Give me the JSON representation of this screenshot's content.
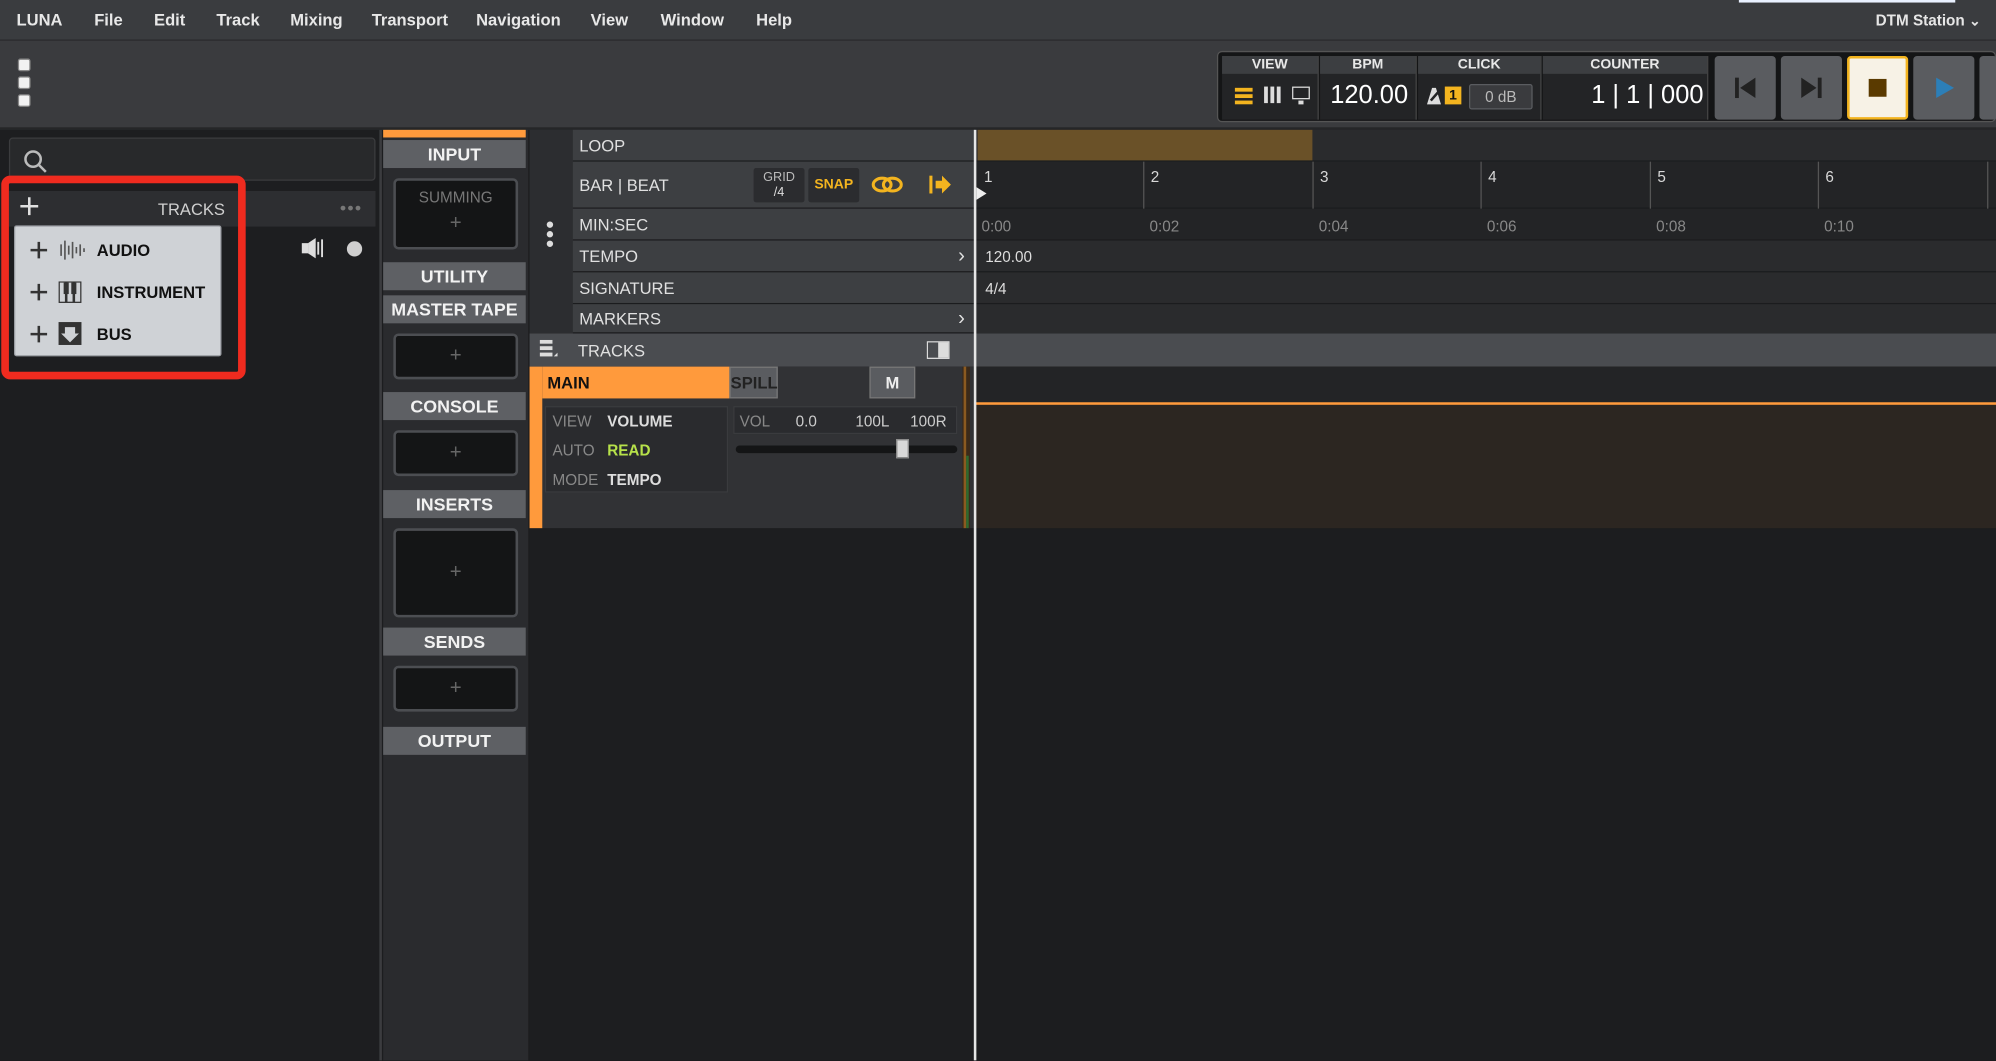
{
  "menu": {
    "items": [
      "LUNA",
      "File",
      "Edit",
      "Track",
      "Mixing",
      "Transport",
      "Navigation",
      "View",
      "Window",
      "Help"
    ],
    "station": "DTM Station"
  },
  "transport": {
    "view_label": "VIEW",
    "bpm_label": "BPM",
    "bpm_value": "120.00",
    "click_label": "CLICK",
    "click_badge": "1",
    "click_db": "0 dB",
    "counter_label": "COUNTER",
    "counter_value": "1 | 1 | 000"
  },
  "tracks_panel": {
    "header": "TRACKS",
    "dropdown": [
      "AUDIO",
      "INSTRUMENT",
      "BUS"
    ]
  },
  "channel_strip": {
    "sections": [
      "INPUT",
      "UTILITY",
      "MASTER TAPE",
      "CONSOLE",
      "INSERTS",
      "SENDS",
      "OUTPUT"
    ],
    "summing_label": "SUMMING"
  },
  "rulers": {
    "rows": [
      "LOOP",
      "BAR | BEAT",
      "MIN:SEC",
      "TEMPO",
      "SIGNATURE",
      "MARKERS"
    ],
    "grid_label": "GRID",
    "grid_value": "/4",
    "snap_label": "SNAP",
    "bars": [
      "1",
      "2",
      "3",
      "4",
      "5",
      "6"
    ],
    "times": [
      "0:00",
      "0:02",
      "0:04",
      "0:06",
      "0:08",
      "0:10"
    ],
    "tempo_value": "120.00",
    "signature_value": "4/4"
  },
  "tracks_bar": {
    "label": "TRACKS"
  },
  "main_track": {
    "name": "MAIN",
    "spill": "SPILL",
    "mute": "M",
    "view_key": "VIEW",
    "view_val": "VOLUME",
    "auto_key": "AUTO",
    "auto_val": "READ",
    "mode_key": "MODE",
    "mode_val": "TEMPO",
    "vol_label": "VOL",
    "vol_value": "0.0",
    "pan_left": "100L",
    "pan_right": "100R"
  },
  "colors": {
    "accent": "#ff9a3c",
    "highlight": "#ef2b1f",
    "snap": "#f3b41f",
    "auto_read": "#b7e24a"
  }
}
